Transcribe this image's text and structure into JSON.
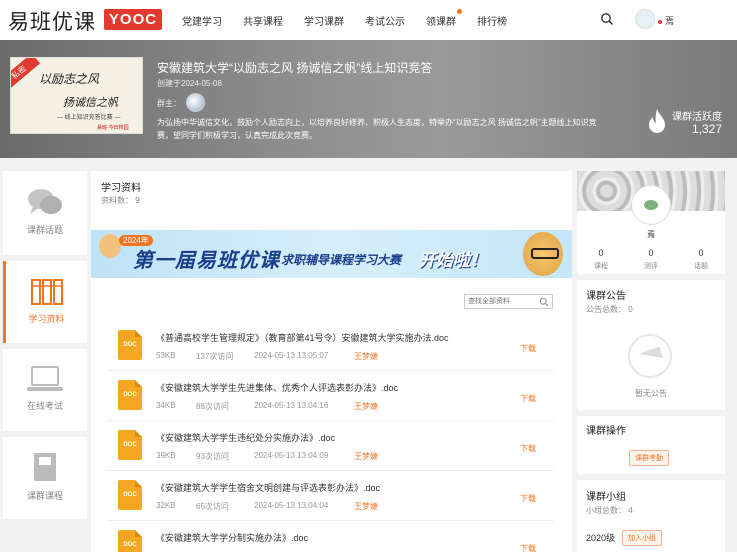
{
  "header": {
    "logo_text": "易班优课",
    "logo_badge": "YOOC",
    "nav": [
      "党建学习",
      "共享课程",
      "学习课群",
      "考试公示",
      "领课群",
      "排行榜"
    ],
    "user_name": "焉"
  },
  "banner": {
    "cover": {
      "tag": "私密",
      "line1": "以励志之风",
      "line2": "扬诚信之帆",
      "line3": "— 线上知识竞答比赛 —",
      "line4": "易班·今日校园"
    },
    "title": "安徽建筑大学“以励志之风 扬诚信之帆”线上知识竞答",
    "created": "创建于2024-05-08",
    "owner_label": "群主：",
    "description": "为弘扬中华诚信文化，鼓励个人励志向上，以培养良好修养、积极人生态度，特举办“以励志之风 扬诚信之帆”主题线上知识竞赛，望同学们积极学习，认真完成此次竞赛。",
    "activity_label": "课群活跃度",
    "activity_value": "1,327"
  },
  "sidebar": [
    {
      "label": "课群话题",
      "icon": "chat-icon",
      "active": false
    },
    {
      "label": "学习资料",
      "icon": "books-icon",
      "active": true
    },
    {
      "label": "在线考试",
      "icon": "laptop-icon",
      "active": false
    },
    {
      "label": "课群课程",
      "icon": "book-icon",
      "active": false
    }
  ],
  "main": {
    "title": "学习资料",
    "count": "资料数： 9",
    "promo": {
      "year": "2024年",
      "headline": "第一届易班优课",
      "sub": "求职辅导课程学习大赛",
      "exclaim": "开始啦！"
    },
    "search_placeholder": "查找全部资料",
    "files": [
      {
        "name": "《普通高校学生管理规定》（教育部第41号令）安徽建筑大学实施办法.doc",
        "size": "53KB",
        "views": "137次访问",
        "time": "2024-05-13 13:05:07",
        "author": "王梦婕",
        "download": "下载"
      },
      {
        "name": "《安徽建筑大学学生先进集体、优秀个人评选表彰办法》.doc",
        "size": "34KB",
        "views": "88次访问",
        "time": "2024-05-13 13:04:16",
        "author": "王梦婕",
        "download": "下载"
      },
      {
        "name": "《安徽建筑大学学生违纪处分实施办法》.doc",
        "size": "39KB",
        "views": "93次访问",
        "time": "2024-05-13 13:04:09",
        "author": "王梦婕",
        "download": "下载"
      },
      {
        "name": "《安徽建筑大学学生宿舍文明创建与评选表彰办法》.doc",
        "size": "32KB",
        "views": "65次访问",
        "time": "2024-05-13 13:04:04",
        "author": "王梦婕",
        "download": "下载"
      },
      {
        "name": "《安徽建筑大学学分制实施办法》.doc",
        "size": "",
        "views": "",
        "time": "",
        "author": "",
        "download": "下载"
      }
    ]
  },
  "right": {
    "profile_name": "焉",
    "stats": [
      {
        "value": "0",
        "label": "课程"
      },
      {
        "value": "0",
        "label": "测评"
      },
      {
        "value": "0",
        "label": "话题"
      }
    ],
    "notice_title": "课群公告",
    "notice_count": "公告总数： 0",
    "notice_empty": "暂无公告",
    "ops_title": "课群操作",
    "ops_button": "课群考勤",
    "group_title": "课群小组",
    "group_count": "小组总数： 4",
    "group_item": "2020级",
    "group_join": "加入小组"
  }
}
